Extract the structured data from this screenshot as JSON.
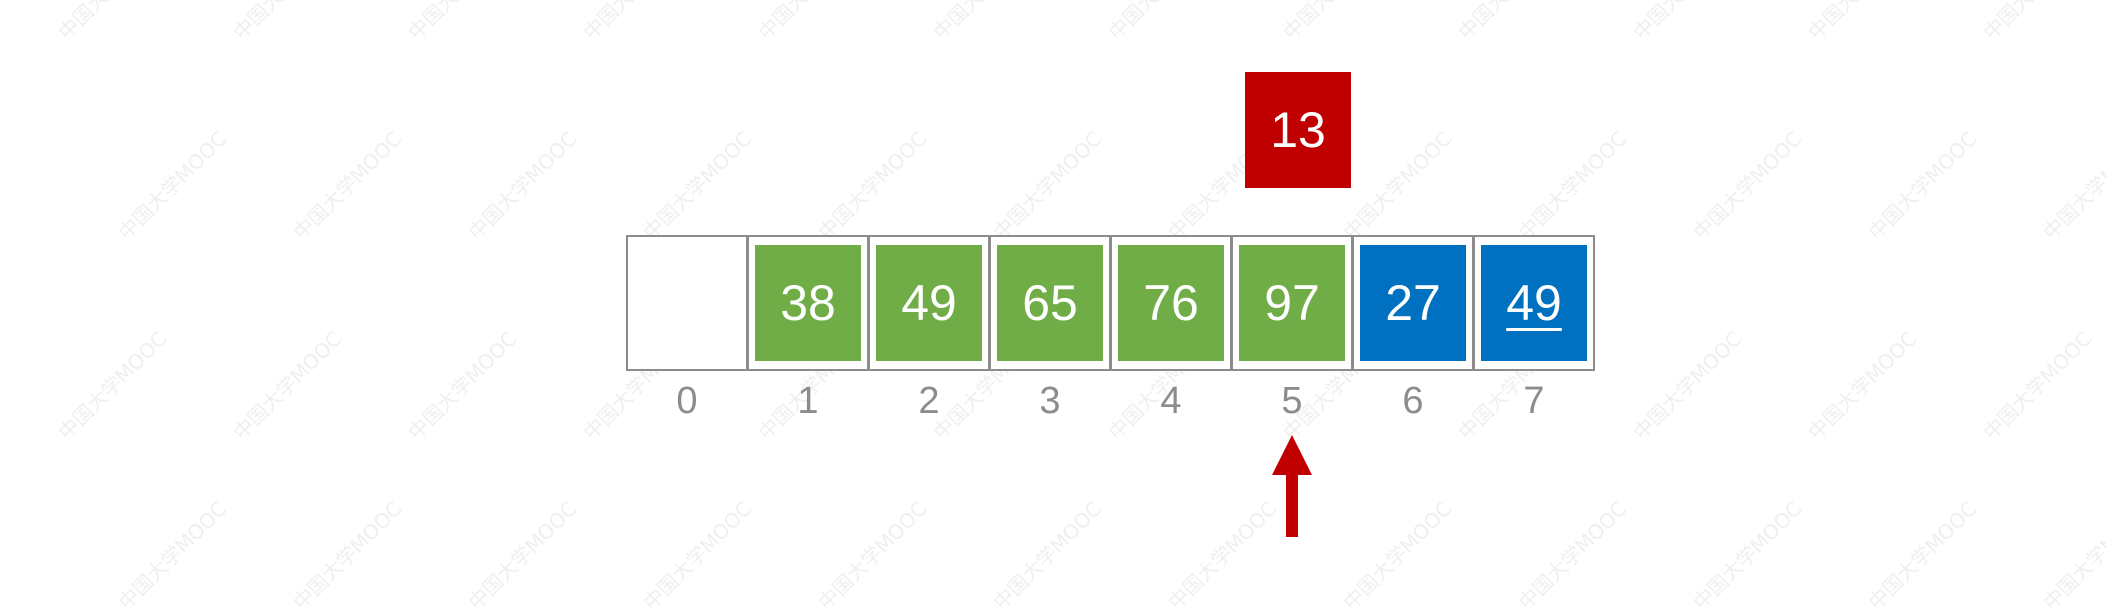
{
  "watermark_text": "中国大学MOOC",
  "key": {
    "value": "13"
  },
  "array": [
    {
      "index": "0",
      "value": "",
      "state": "empty",
      "underline": false
    },
    {
      "index": "1",
      "value": "38",
      "state": "sorted",
      "underline": false
    },
    {
      "index": "2",
      "value": "49",
      "state": "sorted",
      "underline": false
    },
    {
      "index": "3",
      "value": "65",
      "state": "sorted",
      "underline": false
    },
    {
      "index": "4",
      "value": "76",
      "state": "sorted",
      "underline": false
    },
    {
      "index": "5",
      "value": "97",
      "state": "sorted",
      "underline": false
    },
    {
      "index": "6",
      "value": "27",
      "state": "unsorted",
      "underline": false
    },
    {
      "index": "7",
      "value": "49",
      "state": "unsorted",
      "underline": true
    }
  ],
  "pointer": {
    "target_index": 5,
    "icon": "up-arrow-icon"
  },
  "colors": {
    "key": "#c00000",
    "sorted": "#70ad47",
    "unsorted": "#0070c0",
    "border": "#8c8c8c",
    "pointer": "#c00000"
  }
}
